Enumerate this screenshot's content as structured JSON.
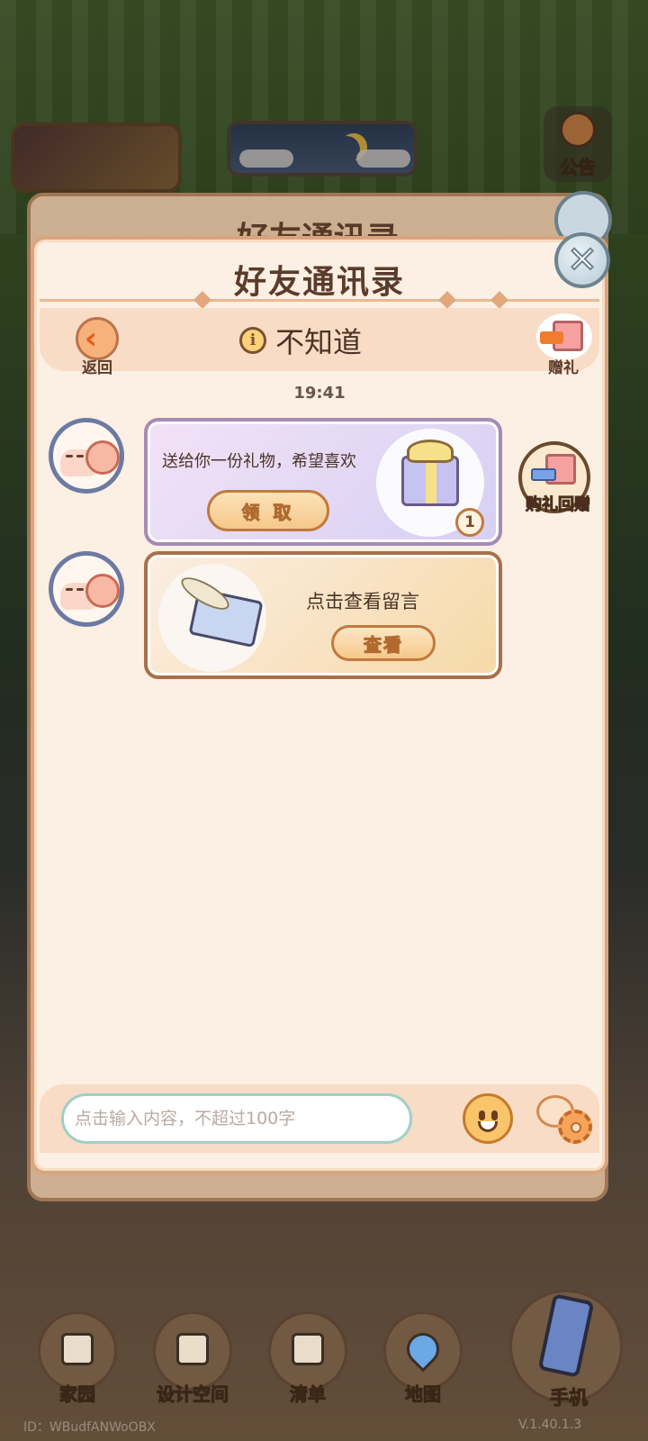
{
  "top": {
    "notice_label": "公告"
  },
  "dialog": {
    "title": "好友通讯录",
    "back_label": "返回",
    "friend_name": "不知道",
    "gift_label": "赠礼",
    "timestamp": "19:41"
  },
  "messages": [
    {
      "type": "gift",
      "text": "送给你一份礼物，希望喜欢",
      "button_label": "领 取",
      "count": "1"
    },
    {
      "type": "letter",
      "text": "点击查看留言",
      "button_label": "查看"
    }
  ],
  "return_gift_label": "购礼回赠",
  "input": {
    "placeholder": "点击输入内容，不超过100字"
  },
  "bottom_nav": {
    "items": [
      {
        "label": "家园",
        "icon": "house-icon"
      },
      {
        "label": "设计空间",
        "icon": "design-icon"
      },
      {
        "label": "清单",
        "icon": "list-icon"
      },
      {
        "label": "地图",
        "icon": "map-pin-icon"
      }
    ],
    "phone_label": "手机"
  },
  "footer": {
    "id_text": "ID：WBudfANWoOBX",
    "version_text": "V.1.40.1.3"
  },
  "colors": {
    "panel_bg": "#fcefe3",
    "panel_border": "#d9a57e",
    "header_band": "#f8dcc6",
    "gift_card_border": "#a68bb6",
    "letter_card_border": "#a8704a",
    "avatar_ring": "#6c7aa3"
  }
}
